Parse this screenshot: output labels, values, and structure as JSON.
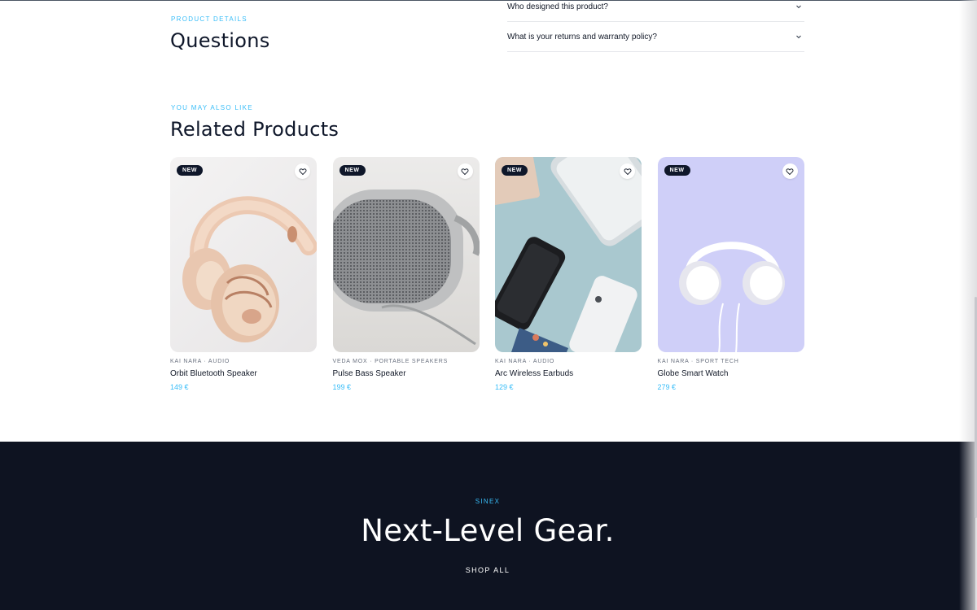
{
  "questions": {
    "eyebrow": "PRODUCT DETAILS",
    "title": "Questions",
    "faq": [
      "Who designed this product?",
      "What is your returns and warranty policy?"
    ]
  },
  "related": {
    "eyebrow": "YOU MAY ALSO LIKE",
    "title": "Related Products",
    "products": [
      {
        "badge": "NEW",
        "meta": "KAI NARA · AUDIO",
        "name": "Orbit Bluetooth Speaker",
        "price": "149 €",
        "image": "rose-gold-headphones"
      },
      {
        "badge": "NEW",
        "meta": "VEDA MOX · PORTABLE SPEAKERS",
        "name": "Pulse Bass Speaker",
        "price": "199 €",
        "image": "grey-portable-speaker"
      },
      {
        "badge": "NEW",
        "meta": "KAI NARA · AUDIO",
        "name": "Arc Wireless Earbuds",
        "price": "129 €",
        "image": "phones-flatlay"
      },
      {
        "badge": "NEW",
        "meta": "KAI NARA · SPORT TECH",
        "name": "Globe Smart Watch",
        "price": "279 €",
        "image": "white-headphones-lavender"
      }
    ]
  },
  "footer": {
    "eyebrow": "SINEX",
    "title": "Next-Level Gear.",
    "link": "SHOP ALL"
  },
  "colors": {
    "accent": "#38bdf8",
    "dark": "#0e1321"
  },
  "icons": [
    "chevron-down-icon",
    "heart-icon"
  ]
}
